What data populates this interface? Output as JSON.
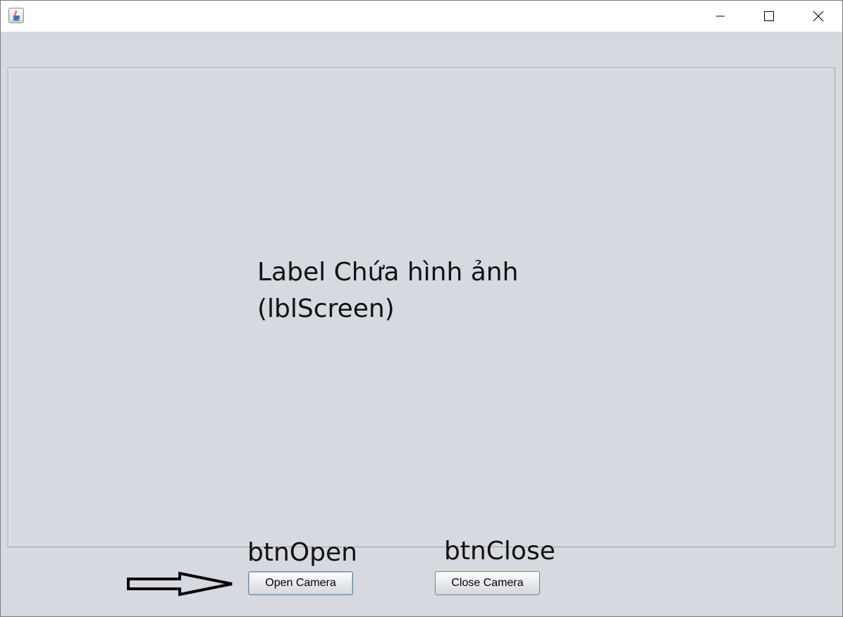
{
  "window": {
    "title": "",
    "icon": "java-cup-icon",
    "controls": [
      "minimize-icon",
      "maximize-icon",
      "close-icon"
    ]
  },
  "screen": {
    "annotation_line1": "Label Chứa hình ảnh",
    "annotation_line2": "(lblScreen)"
  },
  "buttons": {
    "open_label": "Open Camera",
    "close_label": "Close Camera",
    "open_annotation": "btnOpen",
    "close_annotation": "btnClose"
  },
  "colors": {
    "background": "#d6d9e0",
    "titlebar": "#ffffff"
  }
}
